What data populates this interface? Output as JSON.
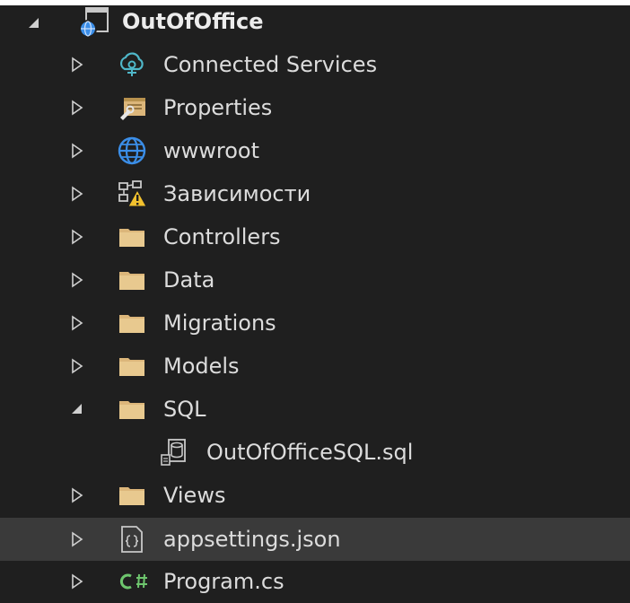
{
  "project": {
    "name": "OutOfOffice",
    "expanded": true
  },
  "items": [
    {
      "label": "Connected Services",
      "icon": "connected-services-icon",
      "expanded": false
    },
    {
      "label": "Properties",
      "icon": "properties-icon",
      "expanded": false
    },
    {
      "label": "wwwroot",
      "icon": "globe-icon",
      "expanded": false
    },
    {
      "label": "Зависимости",
      "icon": "dependencies-warning-icon",
      "expanded": false
    },
    {
      "label": "Controllers",
      "icon": "folder-icon",
      "expanded": false
    },
    {
      "label": "Data",
      "icon": "folder-icon",
      "expanded": false
    },
    {
      "label": "Migrations",
      "icon": "folder-icon",
      "expanded": false
    },
    {
      "label": "Models",
      "icon": "folder-icon",
      "expanded": false
    },
    {
      "label": "SQL",
      "icon": "folder-icon",
      "expanded": true,
      "children": [
        {
          "label": "OutOfOfficeSQL.sql",
          "icon": "sql-file-icon"
        }
      ]
    },
    {
      "label": "Views",
      "icon": "folder-icon",
      "expanded": false
    },
    {
      "label": "appsettings.json",
      "icon": "json-file-icon",
      "expanded": false,
      "selected": true
    },
    {
      "label": "Program.cs",
      "icon": "csharp-file-icon",
      "expanded": false
    }
  ],
  "colors": {
    "background": "#1f1f1f",
    "selected_row": "#3a3a3a",
    "folder": "#dcb67a",
    "globe": "#3b8ee8",
    "csharp": "#6ec66e"
  }
}
